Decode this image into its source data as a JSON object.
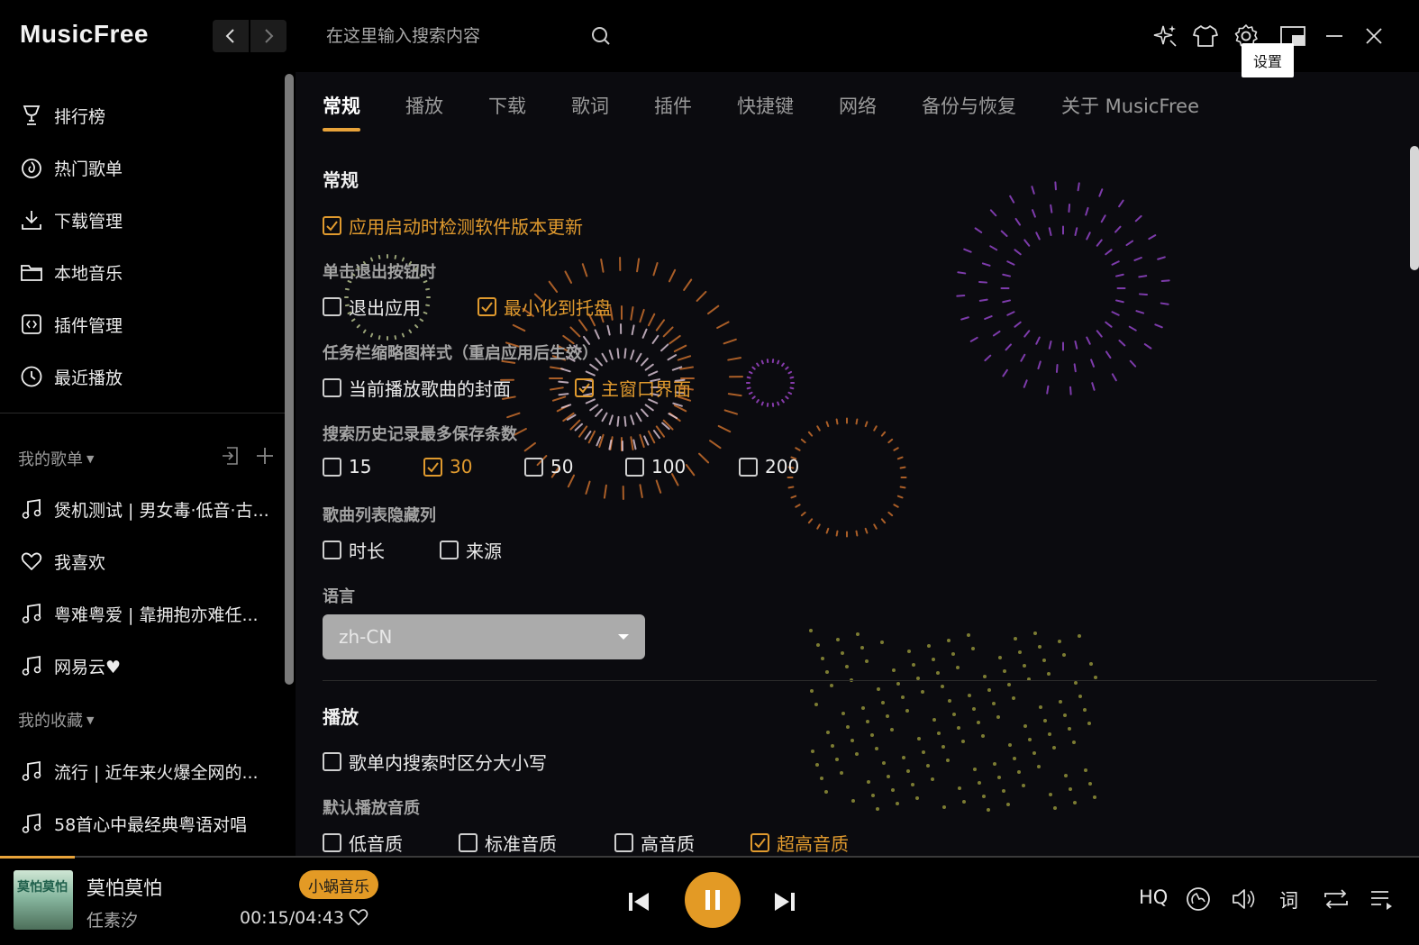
{
  "app": {
    "name": "MusicFree"
  },
  "search": {
    "placeholder": "在这里输入搜索内容"
  },
  "tooltip": "设置",
  "sidebar": {
    "nav": [
      {
        "label": "排行榜",
        "icon": "trophy-icon"
      },
      {
        "label": "热门歌单",
        "icon": "fire-icon"
      },
      {
        "label": "下载管理",
        "icon": "download-icon"
      },
      {
        "label": "本地音乐",
        "icon": "folder-icon"
      },
      {
        "label": "插件管理",
        "icon": "plugin-icon"
      },
      {
        "label": "最近播放",
        "icon": "clock-icon"
      }
    ],
    "my_playlists_title": "我的歌单",
    "my_playlists": [
      {
        "label": "煲机测试 | 男女毒·低音·古...",
        "icon": "music-note-icon"
      },
      {
        "label": "我喜欢",
        "icon": "heart-icon"
      },
      {
        "label": "粤难粤爱 | 靠拥抱亦难任...",
        "icon": "music-note-icon"
      },
      {
        "label": "网易云♥",
        "icon": "music-note-icon"
      }
    ],
    "my_collections_title": "我的收藏",
    "my_collections": [
      {
        "label": "流行 | 近年来火爆全网的...",
        "icon": "music-note-icon"
      },
      {
        "label": "58首心中最经典粤语对唱",
        "icon": "music-note-icon"
      }
    ]
  },
  "settings": {
    "tabs": [
      "常规",
      "播放",
      "下载",
      "歌词",
      "插件",
      "快捷键",
      "网络",
      "备份与恢复",
      "关于 MusicFree"
    ],
    "active_tab": "常规",
    "general_title": "常规",
    "check_update": {
      "label": "应用启动时检测软件版本更新",
      "checked": true
    },
    "exit_label": "单击退出按钮时",
    "exit_options": [
      {
        "label": "退出应用",
        "checked": false
      },
      {
        "label": "最小化到托盘",
        "checked": true
      }
    ],
    "taskbar_label": "任务栏缩略图样式（重启应用后生效）",
    "taskbar_options": [
      {
        "label": "当前播放歌曲的封面",
        "checked": false
      },
      {
        "label": "主窗口界面",
        "checked": true
      }
    ],
    "history_label": "搜索历史记录最多保存条数",
    "history_options": [
      {
        "label": "15",
        "checked": false
      },
      {
        "label": "30",
        "checked": true
      },
      {
        "label": "50",
        "checked": false
      },
      {
        "label": "100",
        "checked": false
      },
      {
        "label": "200",
        "checked": false
      }
    ],
    "hide_cols_label": "歌曲列表隐藏列",
    "hide_cols_options": [
      {
        "label": "时长",
        "checked": false
      },
      {
        "label": "来源",
        "checked": false
      }
    ],
    "language_label": "语言",
    "language_value": "zh-CN",
    "play_title": "播放",
    "case_sensitive": {
      "label": "歌单内搜索时区分大小写",
      "checked": false
    },
    "quality_label": "默认播放音质",
    "quality_options": [
      {
        "label": "低音质",
        "checked": false
      },
      {
        "label": "标准音质",
        "checked": false
      },
      {
        "label": "高音质",
        "checked": false
      },
      {
        "label": "超高音质",
        "checked": true
      }
    ]
  },
  "player": {
    "cover_text": "莫怕莫怕",
    "title": "莫怕莫怕",
    "artist": "任素汐",
    "source": "小蜗音乐",
    "time": "00:15/04:43",
    "progress": 0.053,
    "quality": "HQ",
    "lyric_btn": "词"
  },
  "colors": {
    "accent": "#e8a33a",
    "background": "#0b0b0f",
    "bar": "#000000"
  }
}
